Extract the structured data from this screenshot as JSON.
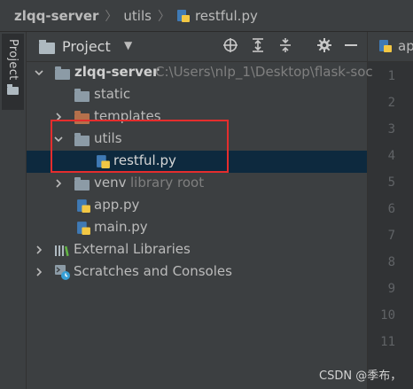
{
  "breadcrumb": {
    "items": [
      "zlqq-server",
      "utils",
      "restful.py"
    ]
  },
  "toolstrip": {
    "project_tab_label": "Project"
  },
  "panel": {
    "title": "Project",
    "dropdown_icon": "triangle-down-icon",
    "toolbar_icons": [
      "locate-icon",
      "expand-all-icon",
      "collapse-all-icon",
      "gear-icon",
      "minimize-icon"
    ]
  },
  "tree": {
    "root": {
      "name": "zlqq-server",
      "path": "C:\\Users\\nlp_1\\Desktop\\flask-soc"
    },
    "static": "static",
    "templates": "templates",
    "utils": "utils",
    "restful": "restful.py",
    "venv": {
      "name": "venv",
      "hint": "library root"
    },
    "app": "app.py",
    "main": "main.py",
    "external": "External Libraries",
    "scratches": "Scratches and Consoles"
  },
  "editor": {
    "tab_label": "ap",
    "line_numbers": [
      "1",
      "2",
      "3",
      "4",
      "5",
      "6",
      "7",
      "8",
      "9",
      "10",
      "11"
    ]
  },
  "watermark": "CSDN @季布，",
  "colors": {
    "annotation_box": "#e52d2d",
    "selected_row": "#0d293e",
    "python_blue": "#3f7ab5",
    "python_yellow": "#f2c744"
  }
}
